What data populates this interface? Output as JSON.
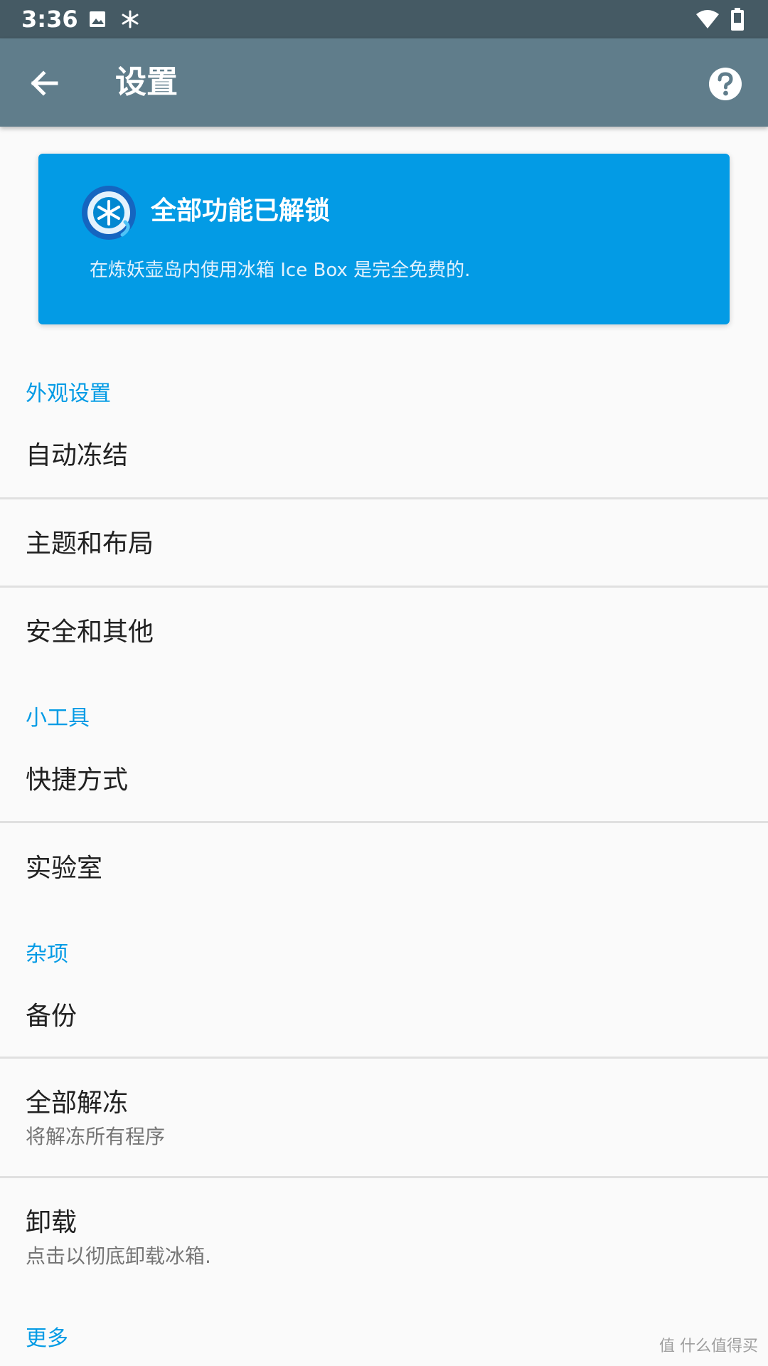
{
  "status_bar": {
    "time": "3:36",
    "icons": [
      "image-icon",
      "snowflake-icon",
      "wifi-icon",
      "battery-icon"
    ]
  },
  "app_bar": {
    "title": "设置",
    "back_icon": "arrow-left-icon",
    "help_icon": "help-circle-icon"
  },
  "unlock_card": {
    "title": "全部功能已解锁",
    "subtitle": "在炼妖壶岛内使用冰箱 Ice Box 是完全免费的."
  },
  "sections": {
    "appearance": {
      "header": "外观设置",
      "items": [
        {
          "title": "自动冻结"
        },
        {
          "title": "主题和布局"
        },
        {
          "title": "安全和其他"
        }
      ]
    },
    "tools": {
      "header": "小工具",
      "items": [
        {
          "title": "快捷方式"
        },
        {
          "title": "实验室"
        }
      ]
    },
    "misc": {
      "header": "杂项",
      "items": [
        {
          "title": "备份"
        },
        {
          "title": "全部解冻",
          "summary": "将解冻所有程序"
        },
        {
          "title": "卸载",
          "summary": "点击以彻底卸载冰箱."
        }
      ]
    },
    "more": {
      "header": "更多"
    }
  },
  "watermark": {
    "text": "值 什么值得买"
  },
  "colors": {
    "status_bar": "#455a64",
    "app_bar": "#607d8b",
    "accent": "#039be5",
    "background": "#fafafa"
  }
}
